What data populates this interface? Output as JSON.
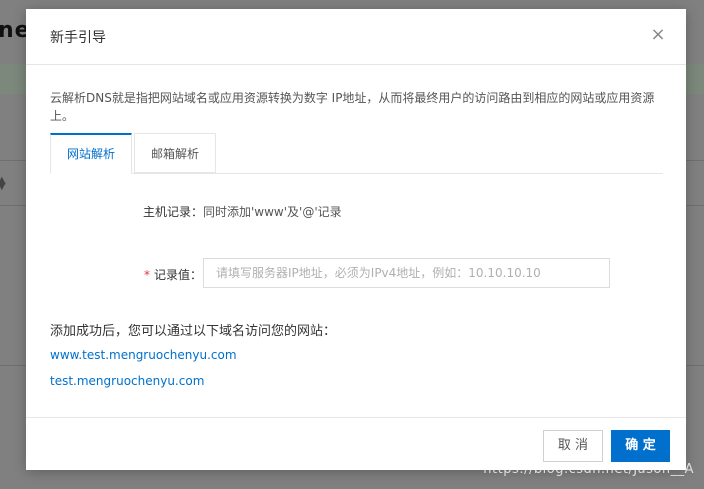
{
  "background": {
    "title_fragment": "ne"
  },
  "modal": {
    "title": "新手引导",
    "close_symbol": "×",
    "description": "云解析DNS就是指把网站域名或应用资源转换为数字 IP地址，从而将最终用户的访问路由到相应的网站或应用资源上。",
    "tabs": [
      {
        "label": "网站解析",
        "active": true
      },
      {
        "label": "邮箱解析",
        "active": false
      }
    ],
    "host_record": {
      "label": "主机记录：",
      "value": "同时添加'www'及'@'记录"
    },
    "record_value": {
      "required_mark": "*",
      "label": "记录值：",
      "value": "",
      "placeholder": "请填写服务器IP地址，必须为IPv4地址，例如：10.10.10.10"
    },
    "success_text": "添加成功后，您可以通过以下域名访问您的网站：",
    "domains": [
      "www.test.mengruochenyu.com",
      "test.mengruochenyu.com"
    ],
    "footer": {
      "cancel_label": "取 消",
      "ok_label": "确 定"
    }
  },
  "watermark": "https://blog.csdn.net/Jason__A",
  "colors": {
    "accent": "#0070cc",
    "required": "#e4393c",
    "overlay": "#808080"
  }
}
